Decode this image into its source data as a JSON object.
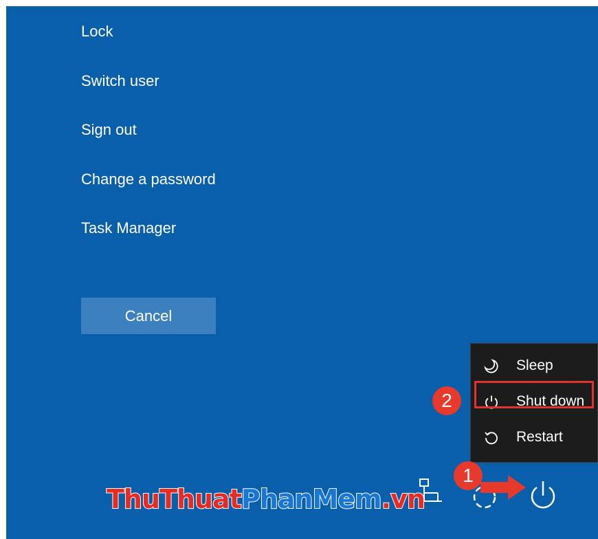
{
  "menu": {
    "items": [
      {
        "label": "Lock"
      },
      {
        "label": "Switch user"
      },
      {
        "label": "Sign out"
      },
      {
        "label": "Change a password"
      },
      {
        "label": "Task Manager"
      }
    ],
    "cancel_label": "Cancel"
  },
  "power_menu": {
    "items": [
      {
        "label": "Sleep",
        "icon": "moon-icon"
      },
      {
        "label": "Shut down",
        "icon": "power-icon"
      },
      {
        "label": "Restart",
        "icon": "restart-icon"
      }
    ]
  },
  "annotations": {
    "step1": "1",
    "step2": "2"
  },
  "watermark": {
    "part1": "ThuThuat",
    "part2": "PhanMem",
    "part3": ".vn"
  },
  "tray": {
    "icons": [
      "network-icon",
      "accessibility-icon",
      "power-icon"
    ]
  },
  "colors": {
    "background": "#0a5fab",
    "cancel_button": "#3c80bf",
    "power_menu": "#1c1c1c",
    "annotation_red": "#e8392d"
  }
}
